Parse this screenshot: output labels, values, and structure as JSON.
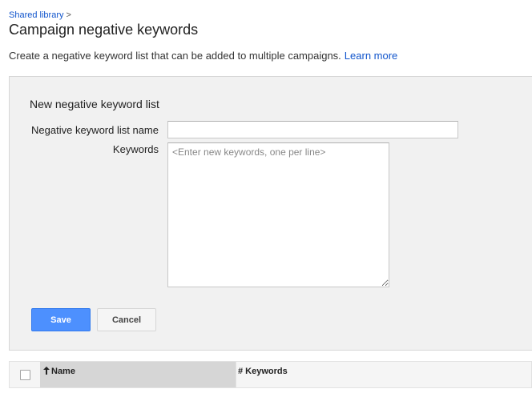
{
  "breadcrumb": {
    "link": "Shared library",
    "separator": ">"
  },
  "page_title": "Campaign negative keywords",
  "description": {
    "text": "Create a negative keyword list that can be added to multiple campaigns.",
    "link": "Learn more"
  },
  "form": {
    "title": "New negative keyword list",
    "name_label": "Negative keyword list name",
    "name_value": "",
    "keywords_label": "Keywords",
    "keywords_placeholder": "<Enter new keywords, one per line>"
  },
  "buttons": {
    "save": "Save",
    "cancel": "Cancel"
  },
  "table": {
    "columns": [
      {
        "label": "Name",
        "sort": "ascending"
      },
      {
        "label": "# Keywords"
      }
    ]
  },
  "colors": {
    "link": "#1155cc",
    "primary_button": "#4d90fe",
    "panel_bg": "#f1f1f1",
    "sorted_column_bg": "#d6d6d6"
  }
}
